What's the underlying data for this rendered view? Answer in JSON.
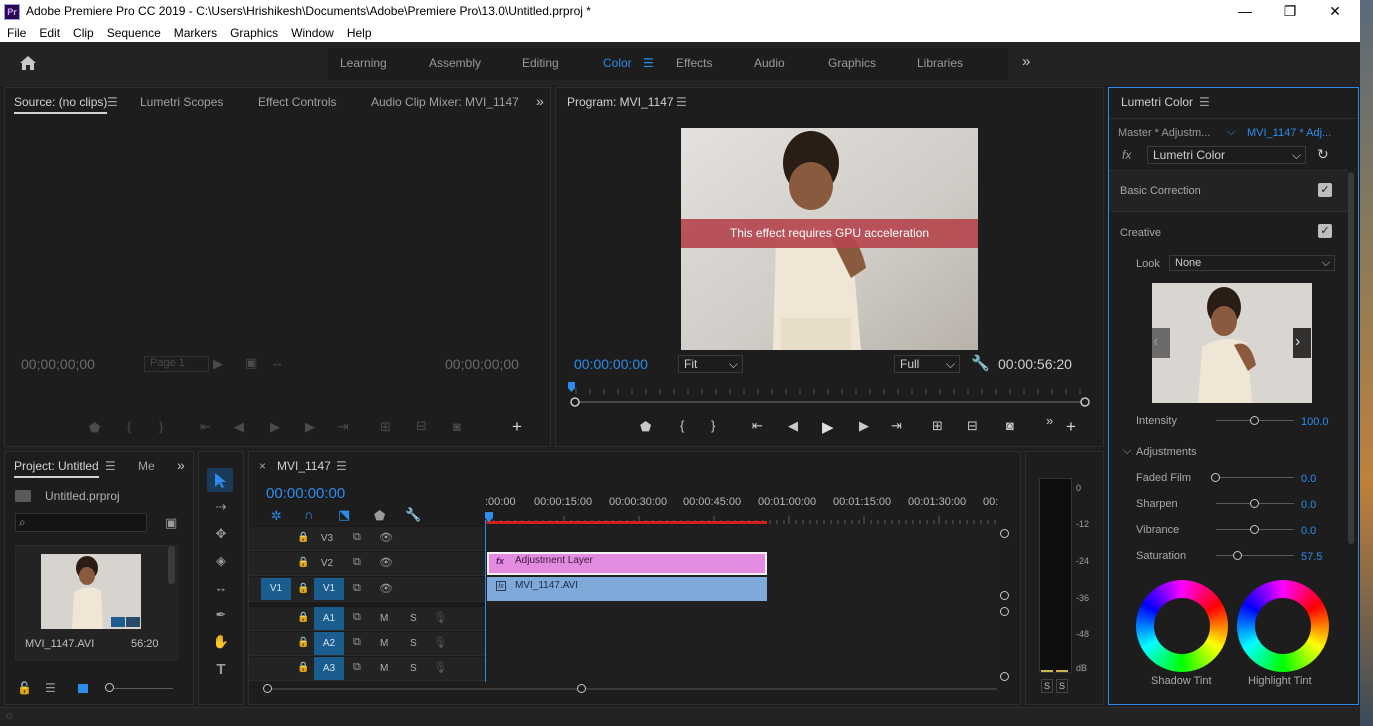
{
  "window": {
    "title": "Adobe Premiere Pro CC 2019 - C:\\Users\\Hrishikesh\\Documents\\Adobe\\Premiere Pro\\13.0\\Untitled.prproj *",
    "app_icon": "Pr",
    "minimize": "—",
    "maximize": "❐",
    "close": "✕"
  },
  "menu": [
    "File",
    "Edit",
    "Clip",
    "Sequence",
    "Markers",
    "Graphics",
    "Window",
    "Help"
  ],
  "workspaces": {
    "items": [
      "Learning",
      "Assembly",
      "Editing",
      "Color",
      "Effects",
      "Audio",
      "Graphics",
      "Libraries"
    ],
    "active": "Color",
    "more": "»"
  },
  "source_panel": {
    "tabs": [
      "Source: (no clips)",
      "Lumetri Scopes",
      "Effect Controls",
      "Audio Clip Mixer: MVI_1147"
    ],
    "timecode_left": "00;00;00;00",
    "page_select": "Page 1",
    "timecode_right": "00;00;00;00"
  },
  "program_panel": {
    "title": "Program: MVI_1147",
    "gpu_message": "This effect requires GPU acceleration",
    "timecode": "00:00:00:00",
    "fit": "Fit",
    "quality": "Full",
    "duration": "00:00:56:20"
  },
  "project_panel": {
    "tab": "Project: Untitled",
    "tab2": "Me",
    "file": "Untitled.prproj",
    "clip_name": "MVI_1147.AVI",
    "clip_duration": "56:20"
  },
  "timeline": {
    "tab": "MVI_1147",
    "timecode": "00:00:00:00",
    "ruler": [
      ":00:00",
      "00:00:15:00",
      "00:00:30:00",
      "00:00:45:00",
      "00:01:00:00",
      "00:01:15:00",
      "00:01:30:00",
      "00:"
    ],
    "video_tracks": [
      "V3",
      "V2",
      "V1"
    ],
    "audio_tracks": [
      "A1",
      "A2",
      "A3"
    ],
    "source_patch": "V1",
    "m": "M",
    "s": "S",
    "clips": {
      "adjustment": "Adjustment Layer",
      "video": "MVI_1147.AVI",
      "fx": "fx"
    }
  },
  "meter": {
    "labels": [
      "0",
      "-12",
      "-24",
      "-36",
      "-48",
      "dB"
    ],
    "solo": [
      "S",
      "S"
    ]
  },
  "lumetri": {
    "title": "Lumetri Color",
    "master_tab": "Master * Adjustm...",
    "clip_tab": "MVI_1147 * Adj...",
    "fx": "fx",
    "effect_select": "Lumetri Color",
    "basic_correction": "Basic Correction",
    "creative": "Creative",
    "look_label": "Look",
    "look_value": "None",
    "intensity_label": "Intensity",
    "intensity_value": "100.0",
    "intensity": 100.0,
    "adjustments": "Adjustments",
    "faded_film_label": "Faded Film",
    "faded_film_value": "0.0",
    "faded_film": 0.0,
    "sharpen_label": "Sharpen",
    "sharpen_value": "0.0",
    "sharpen": 0.0,
    "vibrance_label": "Vibrance",
    "vibrance_value": "0.0",
    "vibrance": 0.0,
    "saturation_label": "Saturation",
    "saturation_value": "57.5",
    "saturation": 57.5,
    "shadow_tint": "Shadow Tint",
    "highlight_tint": "Highlight Tint"
  },
  "colors": {
    "accent": "#2d8ceb",
    "gpu_banner": "#b5474f",
    "adjustment_clip": "#e28be0",
    "video_clip": "#7fa9d8",
    "playhead": "#2d8ceb",
    "work_area": "#d02020"
  }
}
